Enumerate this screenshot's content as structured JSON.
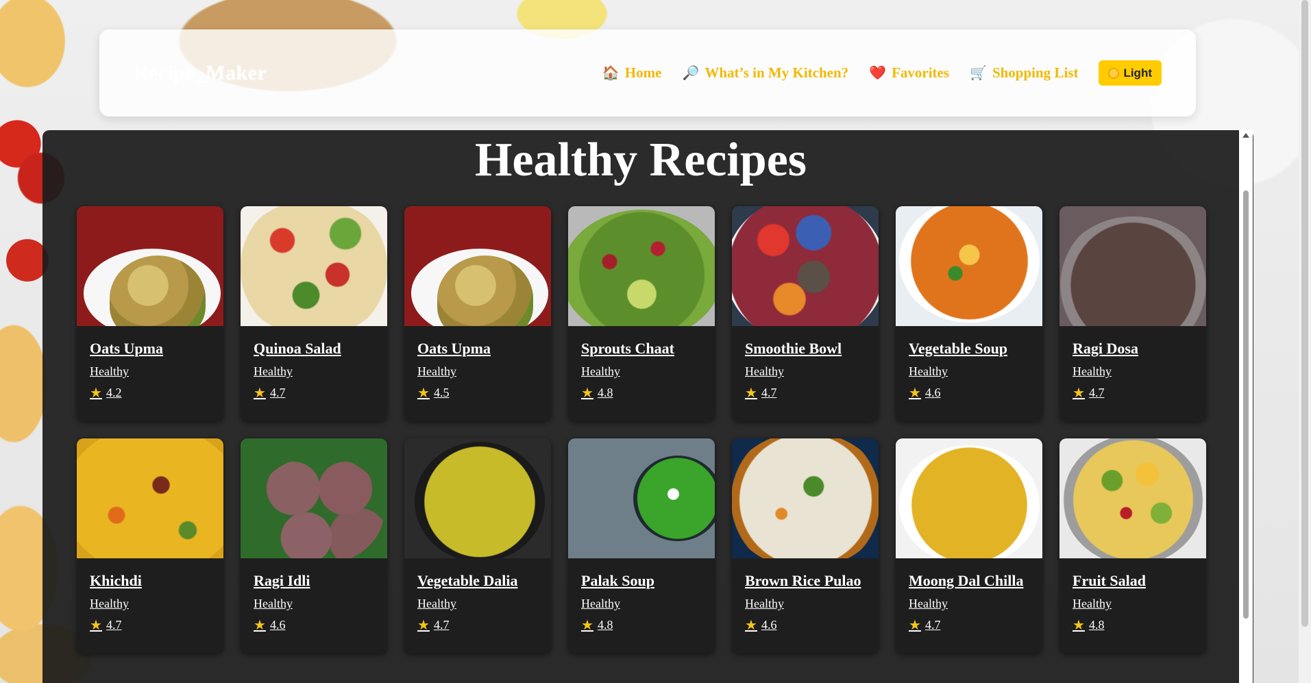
{
  "header": {
    "brand": "Recipe_Maker",
    "nav": [
      {
        "icon": "🏠",
        "icon_name": "house-icon",
        "label": "Home"
      },
      {
        "icon": "🔎",
        "icon_name": "magnifier-icon",
        "label": "What’s in My Kitchen?"
      },
      {
        "icon": "❤️",
        "icon_name": "heart-icon",
        "label": "Favorites"
      },
      {
        "icon": "🛒",
        "icon_name": "cart-icon",
        "label": "Shopping List"
      }
    ],
    "theme_toggle": {
      "label": "Light",
      "icon_name": "sun-icon"
    }
  },
  "main": {
    "title": "Healthy Recipes",
    "recipes": [
      {
        "name": "Oats Upma",
        "category": "Healthy",
        "rating": "4.2",
        "image": "f-upma"
      },
      {
        "name": "Quinoa Salad",
        "category": "Healthy",
        "rating": "4.7",
        "image": "f-quinoa"
      },
      {
        "name": "Oats Upma",
        "category": "Healthy",
        "rating": "4.5",
        "image": "f-upma"
      },
      {
        "name": "Sprouts Chaat",
        "category": "Healthy",
        "rating": "4.8",
        "image": "f-sprouts"
      },
      {
        "name": "Smoothie Bowl",
        "category": "Healthy",
        "rating": "4.7",
        "image": "f-smoothie"
      },
      {
        "name": "Vegetable Soup",
        "category": "Healthy",
        "rating": "4.6",
        "image": "f-soup"
      },
      {
        "name": "Ragi Dosa",
        "category": "Healthy",
        "rating": "4.7",
        "image": "f-ragidosa"
      },
      {
        "name": "Khichdi",
        "category": "Healthy",
        "rating": "4.7",
        "image": "f-khichdi"
      },
      {
        "name": "Ragi Idli",
        "category": "Healthy",
        "rating": "4.6",
        "image": "f-ragiidli"
      },
      {
        "name": "Vegetable Dalia",
        "category": "Healthy",
        "rating": "4.7",
        "image": "f-dalia"
      },
      {
        "name": "Palak Soup",
        "category": "Healthy",
        "rating": "4.8",
        "image": "f-palak"
      },
      {
        "name": "Brown Rice Pulao",
        "category": "Healthy",
        "rating": "4.6",
        "image": "f-pulao"
      },
      {
        "name": "Moong Dal Chilla",
        "category": "Healthy",
        "rating": "4.7",
        "image": "f-chilla"
      },
      {
        "name": "Fruit Salad",
        "category": "Healthy",
        "rating": "4.8",
        "image": "f-fruit"
      }
    ]
  },
  "colors": {
    "accent": "#f2b800",
    "theme_button": "#ffcc00",
    "panel": "#1c1c1c",
    "star": "#f5c518"
  }
}
